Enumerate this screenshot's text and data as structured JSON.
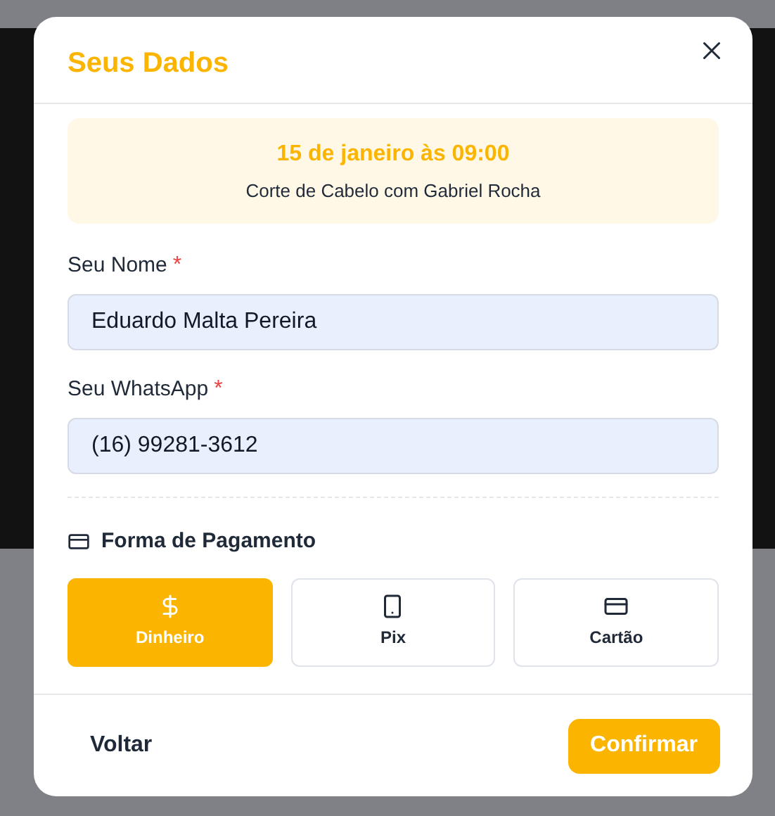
{
  "dialog": {
    "title": "Seus Dados"
  },
  "appointment": {
    "datetime": "15 de janeiro às 09:00",
    "service": "Corte de Cabelo com Gabriel Rocha"
  },
  "fields": [
    {
      "label": "Seu Nome",
      "required_mark": "*",
      "value": "Eduardo Malta Pereira"
    },
    {
      "label": "Seu WhatsApp",
      "required_mark": "*",
      "value": "(16) 99281-3612"
    }
  ],
  "payment": {
    "title": "Forma de Pagamento",
    "options": [
      {
        "kind": "cash",
        "label": "Dinheiro",
        "selected": true
      },
      {
        "kind": "phone",
        "label": "Pix",
        "selected": false
      },
      {
        "kind": "card",
        "label": "Cartão",
        "selected": false
      }
    ]
  },
  "buttons": {
    "back": "Voltar",
    "confirm": "Confirmar"
  }
}
